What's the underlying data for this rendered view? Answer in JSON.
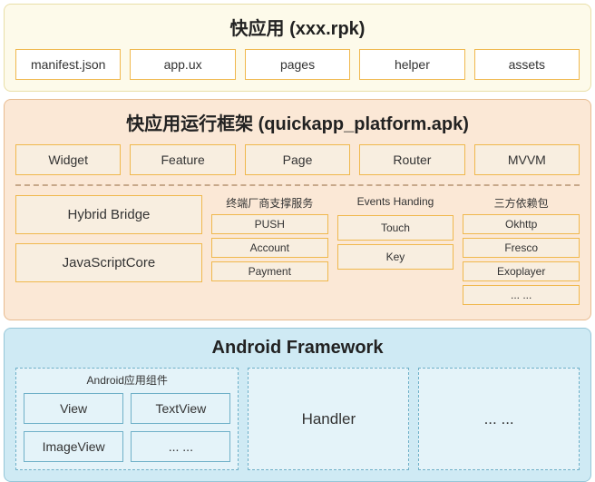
{
  "rpk": {
    "title": "快应用 (xxx.rpk)",
    "items": [
      "manifest.json",
      "app.ux",
      "pages",
      "helper",
      "assets"
    ]
  },
  "platform": {
    "title": "快应用运行框架 (quickapp_platform.apk)",
    "top_row": [
      "Widget",
      "Feature",
      "Page",
      "Router",
      "MVVM"
    ],
    "left_col": [
      "Hybrid Bridge",
      "JavaScriptCore"
    ],
    "vendor": {
      "title": "终端厂商支撑服务",
      "items": [
        "PUSH",
        "Account",
        "Payment"
      ]
    },
    "events": {
      "title": "Events Handing",
      "items": [
        "Touch",
        "Key"
      ]
    },
    "thirdparty": {
      "title": "三方依赖包",
      "items": [
        "Okhttp",
        "Fresco",
        "Exoplayer",
        "... ..."
      ]
    }
  },
  "android": {
    "title": "Android Framework",
    "group_title": "Android应用组件",
    "components": [
      "View",
      "TextView",
      "ImageView",
      "... ..."
    ],
    "big_boxes": [
      "Handler",
      "... ..."
    ]
  },
  "watermark": ""
}
